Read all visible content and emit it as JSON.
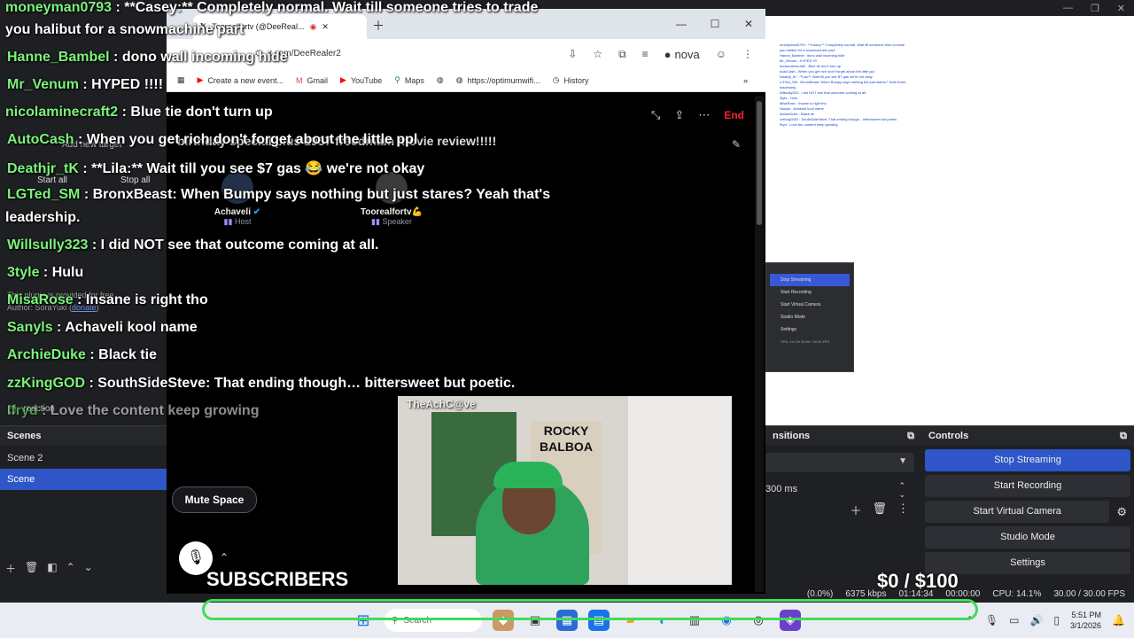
{
  "obs": {
    "chat_mini_lines": [
      "moneyman0793 : **Casey:** Completely normal. Wait till someone tries to trade",
      "you halibut for a snowmachine part",
      "Hanne_Bambel : dono wall incoming hide",
      "Mr_Venum : HYPED !!!!",
      "nicolaminecraft2 : Blue tie don't turn up",
      "AutoCash : When you get rich don't forget about the little ppl",
      "Deathjr_tK : **Lila:** Wait till you see $7 gas we're not okay",
      "LGTed_SM : BronxBeast: When Bumpy says nothing but just stares? Yeah that's",
      "leadership.",
      "Willsully323 : I did NOT see that outcome coming at all.",
      "3tyle : Hulu",
      "MisaRose : Insane is right tho",
      "Sanyls : Achaveli kool name",
      "ArchieDuke : Black tie",
      "zzKingGOD : SouthSideSteve: That ending though... bittersweet but poetic.",
      "Ifryd : Love the content keep growing"
    ],
    "mini_dock_items": [
      "Stop Streaming",
      "Start Recording",
      "Start Virtual Camera",
      "Studio Mode",
      "Settings"
    ],
    "mini_dock_status": "CPU: 14.1%  30.00 / 30.00 FPS",
    "scenes": {
      "header": "Scenes",
      "items": [
        "Scene 2",
        "Scene"
      ]
    },
    "transitions": {
      "header": "nsitions",
      "duration": "300 ms"
    },
    "controls": {
      "header": "Controls",
      "buttons": [
        "Stop Streaming",
        "Start Recording",
        "Start Virtual Camera",
        "Studio Mode",
        "Settings"
      ]
    },
    "status": {
      "dropped": "(0.0%)",
      "bitrate": "6375 kbps",
      "live_time": "01:14:34",
      "rec_time": "00:00:00",
      "cpu": "CPU: 14.1%",
      "fps": "30.00 / 30.00 FPS"
    },
    "behind_chat": {
      "add_target": "Add new target",
      "start_all": "Start all",
      "stop_all": "Stop all",
      "plugin_note": "This plugin is provided for free.",
      "author": "Author: SoraYuki (",
      "donate": "donate",
      "reaction": "reaction"
    }
  },
  "browser": {
    "tab_title": "Toorealfortv (@DeeReal...",
    "url": "x.com/DeeRealer2",
    "bookmarks": [
      "Create a new event...",
      "Gmail",
      "YouTube",
      "Maps",
      "https://optimumwifi...",
      "History"
    ],
    "profile_name": "nova"
  },
  "space": {
    "title": "birthday special plus 1937 freedmam movie review!!!!!",
    "end_label": "End",
    "speakers": [
      {
        "name": "Achaveli",
        "role": "Host"
      },
      {
        "name": "Toorealfortv💪",
        "role": "Speaker"
      }
    ],
    "mute_label": "Mute Space"
  },
  "webcam": {
    "label": "TheAchC@ve",
    "poster_text": [
      "ROCKY",
      "BALBOA"
    ]
  },
  "chat": [
    {
      "user": "moneyman0793",
      "msg": ": **Casey:** Completely normal. Wait till someone tries to trade"
    },
    {
      "user": "",
      "msg": "you halibut for a snowmachine part"
    },
    {
      "user": "Hanne_Bambel",
      "msg": ": dono wall incoming hide"
    },
    {
      "user": "Mr_Venum",
      "msg": ": HYPED !!!!"
    },
    {
      "user": "nicolaminecraft2",
      "msg": ": Blue tie don't turn up"
    },
    {
      "user": "AutoCash",
      "msg": ": When you get rich don't forget about the little ppl"
    },
    {
      "user": "Deathjr_tK",
      "msg": ": **Lila:** Wait till you see $7 gas 😂 we're not okay"
    },
    {
      "user": "LGTed_SM",
      "msg": ": BronxBeast: When Bumpy says nothing but just stares? Yeah that's"
    },
    {
      "user": "",
      "msg": "leadership."
    },
    {
      "user": "Willsully323",
      "msg": ": I did NOT see that outcome coming at all."
    },
    {
      "user": "3tyle",
      "msg": ": Hulu"
    },
    {
      "user": "MisaRose",
      "msg": ": Insane is right tho"
    },
    {
      "user": "Sanyls",
      "msg": ": Achaveli kool name"
    },
    {
      "user": "ArchieDuke",
      "msg": ": Black tie"
    },
    {
      "user": "zzKingGOD",
      "msg": ": SouthSideSteve: That ending though… bittersweet but poetic."
    },
    {
      "user": "Ifryd",
      "msg": ": Love the content keep growing"
    }
  ],
  "overlay": {
    "subscribers": "SUBSCRIBERS",
    "goal": "$0  / $100"
  },
  "taskbar": {
    "search_placeholder": "Search",
    "time": "5:51 PM",
    "date": "3/1/2026"
  },
  "colors": {
    "chat_user": "#7cf37c",
    "obs_accent": "#2e56c8",
    "goal_bar": "#3fdc5a",
    "end_red": "#f4212e"
  }
}
